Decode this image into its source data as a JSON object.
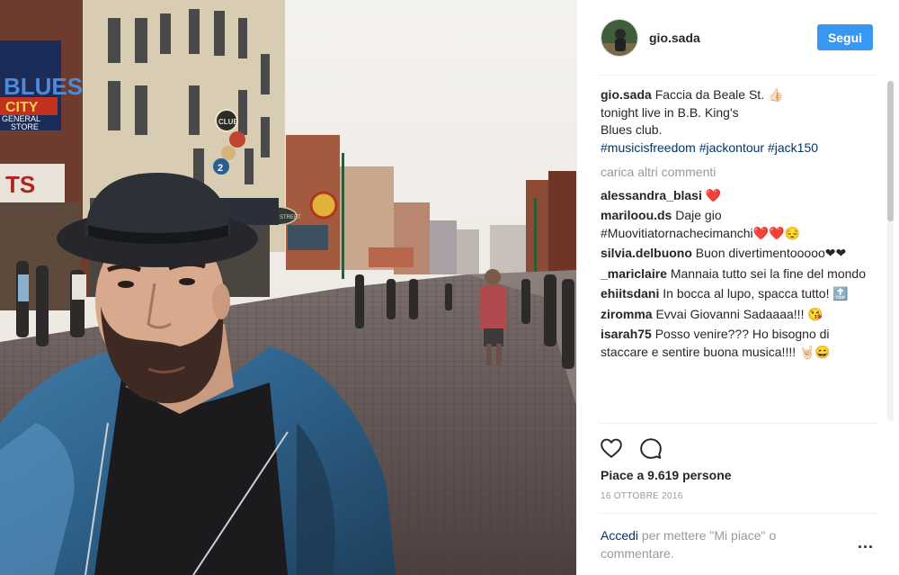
{
  "post": {
    "username": "gio.sada",
    "follow_label": "Segui"
  },
  "photo": {
    "signs": {
      "blues": "BLUES",
      "city": "CITY",
      "store_line1": "GENERAL",
      "store_line2": "STORE",
      "ts": "TS",
      "club": "CLUB",
      "club_num": "2",
      "beale": "BEALE STREET"
    }
  },
  "caption": {
    "user": "gio.sada",
    "line1": "Faccia da Beale St. 👍🏻",
    "line2": "tonight live in B.B. King's",
    "line3": "Blues club.",
    "hashtags": "#musicisfreedom #jackontour #jack150"
  },
  "load_more": "carica altri commenti",
  "comments": [
    {
      "user": "alessandra_blasi",
      "text": "❤️"
    },
    {
      "user": "mariloou.ds",
      "text": "Daje gio #Muovitiatornachecimanchi❤️❤️😔"
    },
    {
      "user": "silvia.delbuono",
      "text": "Buon divertimentooooo❤❤"
    },
    {
      "user": "_mariclaire",
      "text": "Mannaia tutto sei la fine del mondo"
    },
    {
      "user": "ehiitsdani",
      "text": "In bocca al lupo, spacca tutto! 🔝"
    },
    {
      "user": "ziromma",
      "text": "Evvai Giovanni Sadaaaa!!! 😘"
    },
    {
      "user": "isarah75",
      "text": "Posso venire??? Ho bisogno di staccare e sentire buona musica!!!! 🤘🏻😄"
    }
  ],
  "actions": {
    "likes": "Piace a 9.619 persone",
    "date": "16 OTTOBRE 2016"
  },
  "login": {
    "link": "Accedi",
    "text": " per mettere \"Mi piace\" o commentare.",
    "more": "..."
  },
  "icons": [
    "heart-icon",
    "comment-icon",
    "more-options-icon"
  ],
  "colors": {
    "accent": "#3897f0",
    "link": "#003569",
    "muted": "#999999",
    "text": "#262626"
  }
}
